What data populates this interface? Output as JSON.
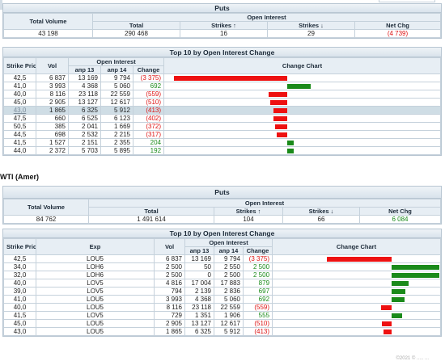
{
  "section2_title": "WTI (Amer)",
  "footer_text": "©2021 © ..... ...",
  "panels": {
    "puts1": {
      "title": "Puts",
      "hdr_total_volume": "Total Volume",
      "hdr_open_interest": "Open Interest",
      "hdr_total": "Total",
      "hdr_strikes_up": "Strikes ↑",
      "hdr_strikes_down": "Strikes ↓",
      "hdr_net_chg": "Net Chg",
      "total_volume": "43 198",
      "total": "290 468",
      "strikes_up": "16",
      "strikes_down": "29",
      "net_chg": "(4 739)"
    },
    "top10_1": {
      "title": "Top 10 by Open Interest Change",
      "hdr_strike": "Strike Price",
      "hdr_vol": "Vol",
      "hdr_oi": "Open Interest",
      "hdr_apr13": "апр 13",
      "hdr_apr14": "апр 14",
      "hdr_change": "Change",
      "hdr_chart": "Change Chart",
      "rows": [
        {
          "strike": "42,5",
          "vol": "6 837",
          "apr13": "13 169",
          "apr14": "9 794",
          "change": "(3 375)",
          "val": -3375
        },
        {
          "strike": "41,0",
          "vol": "3 993",
          "apr13": "4 368",
          "apr14": "5 060",
          "change": "692",
          "val": 692
        },
        {
          "strike": "40,0",
          "vol": "8 116",
          "apr13": "23 118",
          "apr14": "22 559",
          "change": "(559)",
          "val": -559
        },
        {
          "strike": "45,0",
          "vol": "2 905",
          "apr13": "13 127",
          "apr14": "12 617",
          "change": "(510)",
          "val": -510
        },
        {
          "strike": "43,0",
          "vol": "1 865",
          "apr13": "6 325",
          "apr14": "5 912",
          "change": "(413)",
          "val": -413
        },
        {
          "strike": "47,5",
          "vol": "660",
          "apr13": "6 525",
          "apr14": "6 123",
          "change": "(402)",
          "val": -402
        },
        {
          "strike": "50,5",
          "vol": "385",
          "apr13": "2 041",
          "apr14": "1 669",
          "change": "(372)",
          "val": -372
        },
        {
          "strike": "44,5",
          "vol": "698",
          "apr13": "2 532",
          "apr14": "2 215",
          "change": "(317)",
          "val": -317
        },
        {
          "strike": "41,5",
          "vol": "1 527",
          "apr13": "2 151",
          "apr14": "2 355",
          "change": "204",
          "val": 204
        },
        {
          "strike": "44,0",
          "vol": "2 372",
          "apr13": "5 703",
          "apr14": "5 895",
          "change": "192",
          "val": 192
        }
      ]
    },
    "puts2": {
      "title": "Puts",
      "hdr_total_volume": "Total Volume",
      "hdr_open_interest": "Open Interest",
      "hdr_total": "Total",
      "hdr_strikes_up": "Strikes ↑",
      "hdr_strikes_down": "Strikes ↓",
      "hdr_net_chg": "Net Chg",
      "total_volume": "84 762",
      "total": "1 491 614",
      "strikes_up": "104",
      "strikes_down": "66",
      "net_chg": "6 084"
    },
    "top10_2": {
      "title": "Top 10 by Open Interest Change",
      "hdr_strike": "Strike Price",
      "hdr_exp": "Exp",
      "hdr_vol": "Vol",
      "hdr_oi": "Open Interest",
      "hdr_apr13": "апр 13",
      "hdr_apr14": "апр 14",
      "hdr_change": "Change",
      "hdr_chart": "Change Chart",
      "rows": [
        {
          "strike": "42,5",
          "exp": "LOU5",
          "vol": "6 837",
          "apr13": "13 169",
          "apr14": "9 794",
          "change": "(3 375)",
          "val": -3375
        },
        {
          "strike": "34,0",
          "exp": "LOH6",
          "vol": "2 500",
          "apr13": "50",
          "apr14": "2 550",
          "change": "2 500",
          "val": 2500
        },
        {
          "strike": "32,0",
          "exp": "LOH6",
          "vol": "2 500",
          "apr13": "0",
          "apr14": "2 500",
          "change": "2 500",
          "val": 2500
        },
        {
          "strike": "40,0",
          "exp": "LOV5",
          "vol": "4 816",
          "apr13": "17 004",
          "apr14": "17 883",
          "change": "879",
          "val": 879
        },
        {
          "strike": "39,0",
          "exp": "LOV5",
          "vol": "794",
          "apr13": "2 139",
          "apr14": "2 836",
          "change": "697",
          "val": 697
        },
        {
          "strike": "41,0",
          "exp": "LOU5",
          "vol": "3 993",
          "apr13": "4 368",
          "apr14": "5 060",
          "change": "692",
          "val": 692
        },
        {
          "strike": "40,0",
          "exp": "LOU5",
          "vol": "8 116",
          "apr13": "23 118",
          "apr14": "22 559",
          "change": "(559)",
          "val": -559
        },
        {
          "strike": "41,5",
          "exp": "LOV5",
          "vol": "729",
          "apr13": "1 351",
          "apr14": "1 906",
          "change": "555",
          "val": 555
        },
        {
          "strike": "45,0",
          "exp": "LOU5",
          "vol": "2 905",
          "apr13": "13 127",
          "apr14": "12 617",
          "change": "(510)",
          "val": -510
        },
        {
          "strike": "43,0",
          "exp": "LOU5",
          "vol": "1 865",
          "apr13": "6 325",
          "apr14": "5 912",
          "change": "(413)",
          "val": -413
        }
      ]
    }
  }
}
